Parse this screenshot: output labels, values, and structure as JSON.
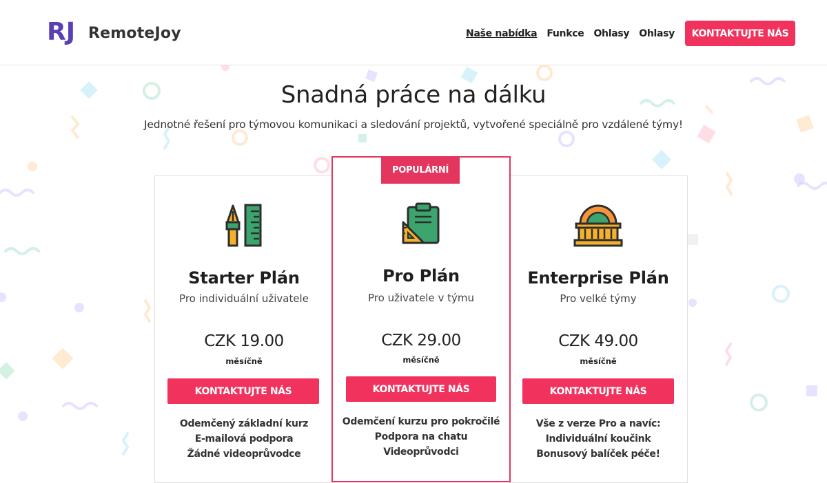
{
  "brand": {
    "logo_mark": "RJ",
    "name": "RemoteJoy"
  },
  "nav": {
    "items": [
      {
        "label": "Naše nabídka",
        "active": true
      },
      {
        "label": "Funkce",
        "active": false
      },
      {
        "label": "Ohlasy",
        "active": false
      },
      {
        "label": "Ohlasy",
        "active": false
      }
    ],
    "cta_label": "KONTAKTUJTE NÁS"
  },
  "hero": {
    "title": "Snadná práce na dálku",
    "subtitle": "Jednotné řešení pro týmovou komunikaci a sledování projektů, vytvořené speciálně pro vzdálené týmy!"
  },
  "plans": [
    {
      "icon": "pen-ruler-icon",
      "title": "Starter Plán",
      "subtitle": "Pro individuální uživatele",
      "price": "CZK 19.00",
      "period": "měsíčně",
      "cta_label": "KONTAKTUJTE NÁS",
      "features": [
        "Odemčený základní kurz",
        "E-mailová podpora",
        "Žádné videoprůvodce"
      ]
    },
    {
      "badge": "POPULÁRNÍ",
      "icon": "clipboard-set-square-icon",
      "title": "Pro Plán",
      "subtitle": "Pro uživatele v týmu",
      "price": "CZK 29.00",
      "period": "měsíčně",
      "cta_label": "KONTAKTUJTE NÁS",
      "features": [
        "Odemčení kurzu pro pokročilé",
        "Podpora na chatu",
        "Videoprůvodci"
      ]
    },
    {
      "icon": "building-icon",
      "title": "Enterprise Plán",
      "subtitle": "Pro velké týmy",
      "price": "CZK 49.00",
      "period": "měsíčně",
      "cta_label": "KONTAKTUJTE NÁS",
      "features": [
        "Vše z verze Pro a navíc:",
        "Individuální koučink",
        "Bonusový balíček péče!"
      ]
    }
  ],
  "colors": {
    "accent": "#f0325c",
    "brand_purple": "#5b3fb5",
    "icon_dark": "#2d2d2d",
    "icon_yellow": "#f6b12c",
    "icon_green": "#3ca56d",
    "icon_orange": "#f5953a"
  }
}
